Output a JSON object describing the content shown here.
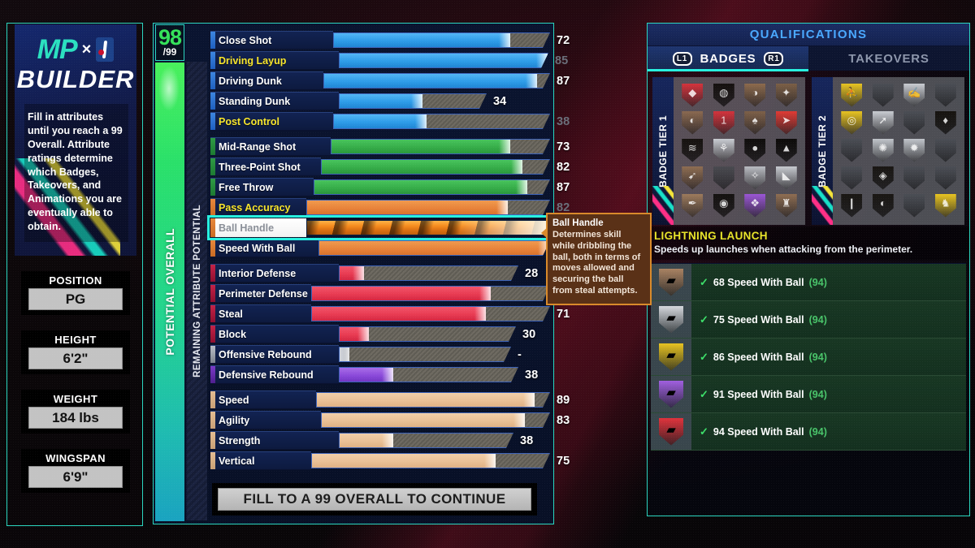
{
  "brand": {
    "mp": "MP",
    "x": "×",
    "nba_icon": "nba-logo-icon",
    "builder": "BUILDER",
    "description": "Fill in attributes until you reach a 99 Overall. Attribute ratings determine which Badges, Takeovers, and Animations you are eventually able to obtain."
  },
  "player": {
    "cards": [
      {
        "label": "POSITION",
        "value": "PG"
      },
      {
        "label": "HEIGHT",
        "value": "6'2\""
      },
      {
        "label": "WEIGHT",
        "value": "184 lbs"
      },
      {
        "label": "WINGSPAN",
        "value": "6'9\""
      }
    ]
  },
  "overall": {
    "value": "98",
    "max": "/99",
    "bar_label": "POTENTIAL OVERALL",
    "potential_label": "REMAINING ATTRIBUTE POTENTIAL"
  },
  "attributes": {
    "rows": [
      {
        "name": "Close Shot",
        "value": "72",
        "fill": 72,
        "cap": 88,
        "color": "blue",
        "capped": false,
        "dim": false
      },
      {
        "name": "Driving Layup",
        "value": "85",
        "fill": 85,
        "cap": 85,
        "color": "blue",
        "capped": true,
        "dim": true
      },
      {
        "name": "Driving Dunk",
        "value": "87",
        "fill": 87,
        "cap": 92,
        "color": "blue",
        "capped": false,
        "dim": false
      },
      {
        "name": "Standing Dunk",
        "value": "34",
        "fill": 34,
        "cap": 60,
        "color": "blue",
        "capped": false,
        "dim": false
      },
      {
        "name": "Post Control",
        "value": "38",
        "fill": 38,
        "cap": 88,
        "color": "blue",
        "capped": true,
        "dim": true
      },
      {
        "name": "Mid-Range Shot",
        "value": "73",
        "fill": 73,
        "cap": 89,
        "color": "green",
        "capped": false,
        "dim": false
      },
      {
        "name": "Three-Point Shot",
        "value": "82",
        "fill": 82,
        "cap": 93,
        "color": "green",
        "capped": false,
        "dim": false
      },
      {
        "name": "Free Throw",
        "value": "87",
        "fill": 87,
        "cap": 96,
        "color": "green",
        "capped": false,
        "dim": false
      },
      {
        "name": "Pass Accuracy",
        "value": "82",
        "fill": 82,
        "cap": 99,
        "color": "orange",
        "capped": true,
        "dim": true
      },
      {
        "name": "Ball Handle",
        "value": "98",
        "fill": 98,
        "cap": 99,
        "color": "fire",
        "capped": false,
        "dim": false,
        "selected": true
      },
      {
        "name": "Speed With Ball",
        "value": "94",
        "fill": 94,
        "cap": 94,
        "color": "orange",
        "capped": false,
        "dim": false
      },
      {
        "name": "Interior Defense",
        "value": "28",
        "fill": 10,
        "cap": 73,
        "color": "red",
        "capped": false,
        "dim": false
      },
      {
        "name": "Perimeter Defense",
        "value": "73",
        "fill": 73,
        "cap": 97,
        "color": "red",
        "capped": false,
        "dim": false
      },
      {
        "name": "Steal",
        "value": "71",
        "fill": 71,
        "cap": 97,
        "color": "red",
        "capped": false,
        "dim": false
      },
      {
        "name": "Block",
        "value": "30",
        "fill": 12,
        "cap": 72,
        "color": "red",
        "capped": false,
        "dim": false
      },
      {
        "name": "Offensive Rebound",
        "value": "-",
        "fill": 4,
        "cap": 70,
        "color": "none",
        "capped": false,
        "dim": false
      },
      {
        "name": "Defensive Rebound",
        "value": "38",
        "fill": 22,
        "cap": 73,
        "color": "purple",
        "capped": false,
        "dim": false
      },
      {
        "name": "Speed",
        "value": "89",
        "fill": 89,
        "cap": 95,
        "color": "tan",
        "capped": false,
        "dim": false
      },
      {
        "name": "Agility",
        "value": "83",
        "fill": 83,
        "cap": 93,
        "color": "tan",
        "capped": false,
        "dim": false
      },
      {
        "name": "Strength",
        "value": "38",
        "fill": 22,
        "cap": 71,
        "color": "tan",
        "capped": false,
        "dim": false
      },
      {
        "name": "Vertical",
        "value": "75",
        "fill": 75,
        "cap": 97,
        "color": "tan",
        "capped": false,
        "dim": false
      }
    ]
  },
  "continue_button": "FILL TO A 99 OVERALL TO CONTINUE",
  "tooltip": {
    "title": "Ball Handle",
    "body": "Determines skill while dribbling the ball, both in terms of moves allowed and securing the ball from steal attempts."
  },
  "qualifications": {
    "header": "QUALIFICATIONS",
    "tabs": [
      {
        "label": "BADGES",
        "active": true,
        "left_bumper": "L1",
        "right_bumper": "R1"
      },
      {
        "label": "TAKEOVERS",
        "active": false
      }
    ],
    "tier1_label": "BADGE TIER 1",
    "tier2_label": "BADGE TIER 2",
    "tier1_badges": [
      {
        "color": "#d4333c",
        "glyph": "◆",
        "selected": false
      },
      {
        "color": "#15100f",
        "glyph": "◍",
        "selected": false
      },
      {
        "color": "#8c6a4d",
        "glyph": "◑",
        "selected": false
      },
      {
        "color": "#7b5f46",
        "glyph": "✦",
        "selected": false
      },
      {
        "color": "#8a6950",
        "glyph": "◐",
        "selected": false
      },
      {
        "color": "#d4333c",
        "glyph": "1",
        "selected": false
      },
      {
        "color": "#7d6048",
        "glyph": "♠",
        "selected": false
      },
      {
        "color": "#e03a34",
        "glyph": "➤",
        "selected": true
      },
      {
        "color": "#16120f",
        "glyph": "≋",
        "selected": false
      },
      {
        "color": "#c9ccd2",
        "glyph": "⚘",
        "selected": false
      },
      {
        "color": "#0f0d0c",
        "glyph": "●",
        "selected": false
      },
      {
        "color": "#0c0a09",
        "glyph": "▲",
        "selected": false
      },
      {
        "color": "#8e6d52",
        "glyph": "➹",
        "selected": false
      },
      {
        "color": "#4a4a50",
        "glyph": "",
        "selected": false
      },
      {
        "color": "#b9bcc2",
        "glyph": "✧",
        "selected": false
      },
      {
        "color": "#c7cad0",
        "glyph": "◣",
        "selected": false
      },
      {
        "color": "#9c7a5c",
        "glyph": "✒",
        "selected": false
      },
      {
        "color": "#141110",
        "glyph": "◉",
        "selected": false
      },
      {
        "color": "#9a56d6",
        "glyph": "❖",
        "selected": false
      },
      {
        "color": "#8e6d52",
        "glyph": "♜",
        "selected": false
      }
    ],
    "tier2_badges": [
      {
        "color": "#e8c421",
        "glyph": "⛹",
        "selected": false
      },
      {
        "color": "#4b4e55",
        "glyph": "",
        "selected": false
      },
      {
        "color": "#c9ccd2",
        "glyph": "✍",
        "selected": false
      },
      {
        "color": "#4b4e55",
        "glyph": "",
        "selected": false
      },
      {
        "color": "#e8c421",
        "glyph": "◎",
        "selected": false
      },
      {
        "color": "#c9ccd2",
        "glyph": "➚",
        "selected": false
      },
      {
        "color": "#4b4e55",
        "glyph": "",
        "selected": false
      },
      {
        "color": "#16130f",
        "glyph": "♦",
        "selected": false
      },
      {
        "color": "#4b4e55",
        "glyph": "",
        "selected": false
      },
      {
        "color": "#c0c4ca",
        "glyph": "✺",
        "selected": false
      },
      {
        "color": "#c0c4ca",
        "glyph": "✹",
        "selected": false
      },
      {
        "color": "#4b4e55",
        "glyph": "",
        "selected": false
      },
      {
        "color": "#4b4e55",
        "glyph": "",
        "selected": false
      },
      {
        "color": "#191613",
        "glyph": "◈",
        "selected": false
      },
      {
        "color": "#4b4e55",
        "glyph": "",
        "selected": false
      },
      {
        "color": "#4b4e55",
        "glyph": "",
        "selected": false
      },
      {
        "color": "#191613",
        "glyph": "❙",
        "selected": false
      },
      {
        "color": "#191613",
        "glyph": "◐",
        "selected": false
      },
      {
        "color": "#4b4e55",
        "glyph": "",
        "selected": false
      },
      {
        "color": "#e8c421",
        "glyph": "♞",
        "selected": false
      }
    ],
    "takeover": {
      "title": "LIGHTNING LAUNCH",
      "description": "Speeds up launches when attacking from the perimeter."
    },
    "requirements": [
      {
        "tier": "bronze",
        "color": "#a98262",
        "check": "✓",
        "text": "68 Speed With Ball",
        "current": "(94)"
      },
      {
        "tier": "silver",
        "color": "#d4d7dc",
        "check": "✓",
        "text": "75 Speed With Ball",
        "current": "(94)"
      },
      {
        "tier": "gold",
        "color": "#e8c421",
        "check": "✓",
        "text": "86 Speed With Ball",
        "current": "(94)"
      },
      {
        "tier": "hof",
        "color": "#a05fe0",
        "check": "✓",
        "text": "91 Speed With Ball",
        "current": "(94)"
      },
      {
        "tier": "legend",
        "color": "#e0333c",
        "check": "✓",
        "text": "94 Speed With Ball",
        "current": "(94)"
      }
    ]
  }
}
